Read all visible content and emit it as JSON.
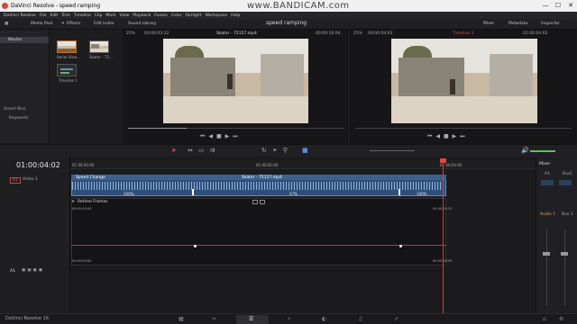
{
  "window": {
    "title": "DaVinci Resolve - speed ramping",
    "minimize": "—",
    "maximize": "☐",
    "close": "✕"
  },
  "watermark": "www.BANDICAM.com",
  "menu": [
    "DaVinci Resolve",
    "File",
    "Edit",
    "Trim",
    "Timeline",
    "Clip",
    "Mark",
    "View",
    "Playback",
    "Fusion",
    "Color",
    "Fairlight",
    "Workspace",
    "Help"
  ],
  "project_title": "speed ramping",
  "toolbar": {
    "media_pool": "Media Pool",
    "effects": "Effects",
    "edit_index": "Edit Index",
    "sound_library": "Sound Library",
    "mixer": "Mixer",
    "metadata": "Metadata",
    "inspector": "Inspector"
  },
  "media": {
    "master": "Master",
    "smart_bins": "Smart Bins",
    "keywords": "Keywords",
    "clips": [
      {
        "name": "Aerial View..."
      },
      {
        "name": "Skater - 75..."
      },
      {
        "name": "Timeline 1"
      }
    ]
  },
  "source_viewer": {
    "zoom": "25%",
    "timecode_left": "00:00:03:22",
    "clip_name": "Skater - 75157.mp4",
    "timecode_right": "00:00:16:04"
  },
  "timeline_viewer": {
    "zoom": "25%",
    "timecode_left": "00:00:04:03",
    "timeline_name": "Timeline 1",
    "timecode_right": "01:00:04:02"
  },
  "timeline": {
    "timecode": "01:00:04:02",
    "ruler": [
      "01:00:00:00",
      "01:00:02:00",
      "01:00:04:00"
    ],
    "video_track": {
      "label": "V1",
      "name": "Video 1"
    },
    "audio_track": {
      "label": "A1"
    },
    "clip": {
      "speed_label": "Speed Change",
      "name": "Skater - 75157.mp4",
      "speeds": [
        "100%",
        "57%",
        "100%"
      ]
    },
    "retime": {
      "label": "Retime Frames",
      "tc_start": "00:01:00:00",
      "tc_end": "00:00:04:13",
      "tc_bottom_start": "00:00:00:00",
      "tc_bottom_end": "00:00:08:09"
    }
  },
  "mixer": {
    "title": "Mixer",
    "channels": [
      "A1",
      "Bus1"
    ],
    "audio": "Audio 1",
    "bus": "Bus 1"
  },
  "footer": {
    "app": "DaVinci Resolve 16"
  },
  "colors": {
    "accent": "#e2524a",
    "clip": "#2f4e79",
    "playhead": "#d4403a"
  }
}
